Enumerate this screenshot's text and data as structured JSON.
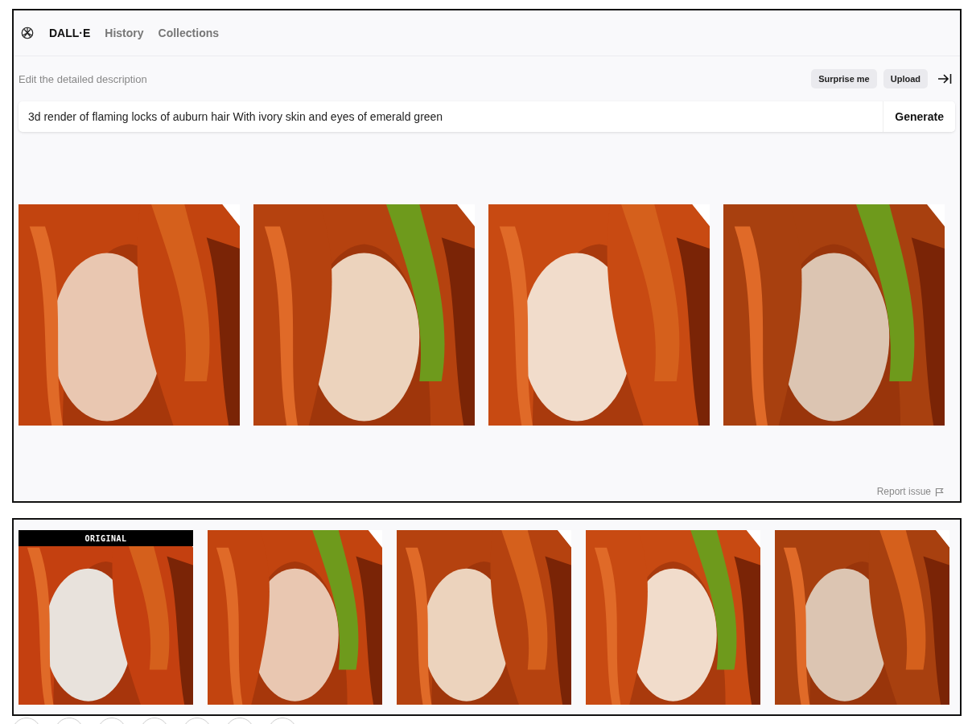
{
  "nav": {
    "items": [
      {
        "label": "DALL·E",
        "selected": true
      },
      {
        "label": "History",
        "selected": false
      },
      {
        "label": "Collections",
        "selected": false
      }
    ]
  },
  "editor": {
    "label": "Edit the detailed description",
    "actions": [
      "Surprise me",
      "Upload"
    ],
    "prompt": {
      "value": "3d render of flaming locks of auburn hair With ivory skin and eyes of emerald green"
    },
    "submit": "Generate"
  },
  "results": [
    {
      "kind": "picture"
    },
    {
      "kind": "picture"
    },
    {
      "kind": "picture"
    },
    {
      "kind": "picture"
    }
  ],
  "report": "Report issue",
  "variations": [
    {
      "kind": "picture",
      "badge": "ORIGINAL"
    },
    {
      "kind": "picture"
    },
    {
      "kind": "picture"
    },
    {
      "kind": "picture"
    },
    {
      "kind": "picture"
    }
  ]
}
